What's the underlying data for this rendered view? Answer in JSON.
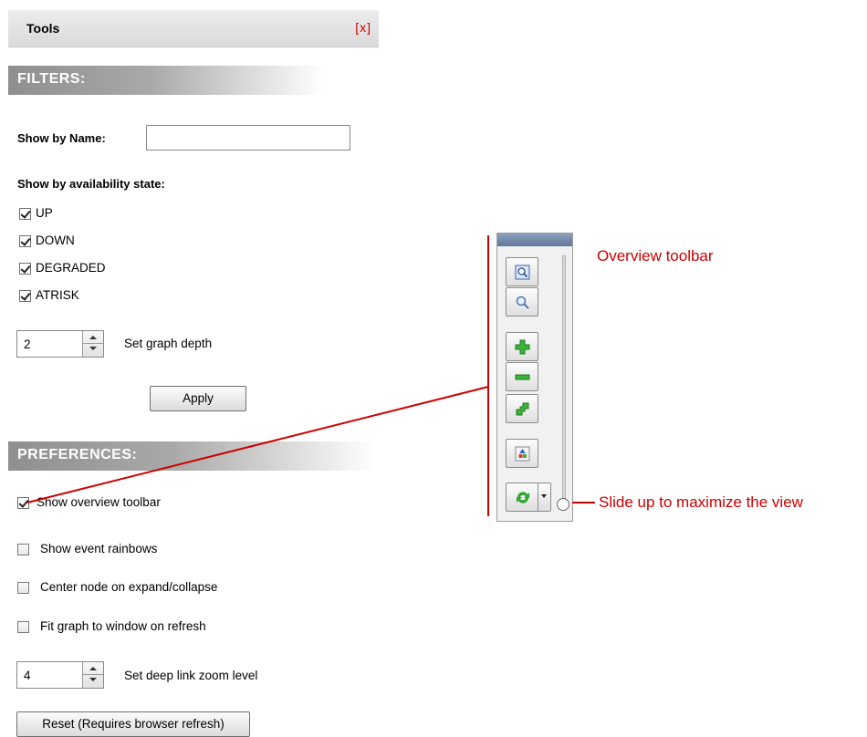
{
  "panel": {
    "title": "Tools",
    "close_label": "[x]"
  },
  "filters": {
    "section_title": "FILTERS:",
    "name_label": "Show by Name:",
    "name_value": "",
    "availability_label": "Show by availability state:",
    "states": [
      {
        "label": "UP",
        "checked": true
      },
      {
        "label": "DOWN",
        "checked": true
      },
      {
        "label": "DEGRADED",
        "checked": true
      },
      {
        "label": "ATRISK",
        "checked": true
      }
    ],
    "depth_value": "2",
    "depth_label": "Set graph depth",
    "apply_label": "Apply"
  },
  "preferences": {
    "section_title": "PREFERENCES:",
    "options": [
      {
        "label": "Show overview toolbar",
        "checked": true
      },
      {
        "label": "Show event rainbows",
        "checked": false
      },
      {
        "label": "Center node on expand/collapse",
        "checked": false
      },
      {
        "label": "Fit graph to window on refresh",
        "checked": false
      }
    ],
    "zoom_value": "4",
    "zoom_label": "Set deep link zoom level",
    "reset_label": "Reset (Requires browser refresh)"
  },
  "annotations": {
    "toolbar_label": "Overview toolbar",
    "slider_label": "Slide up to maximize the view",
    "color": "#cc0000"
  },
  "toolbar_icons": [
    "zoom-fit-icon",
    "zoom-icon",
    "zoom-in-icon",
    "zoom-out-icon",
    "expand-icon",
    "layout-icon",
    "refresh-icon"
  ]
}
